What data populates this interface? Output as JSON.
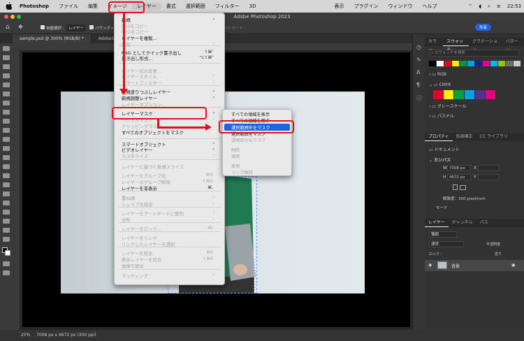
{
  "menubar": {
    "app": "Photoshop",
    "items": [
      "ファイル",
      "編集",
      "イメージ",
      "レイヤー",
      "書式",
      "選択範囲",
      "フィルター",
      "3D",
      "表示",
      "プラグイン",
      "ウィンドウ",
      "ヘルプ"
    ],
    "time": "22:53"
  },
  "window_title": "Adobe Photoshop 2023",
  "options_bar": {
    "auto_select": "自動選択 :",
    "layer": "レイヤー",
    "bounding": "バウンディ",
    "mode3d": "3D モード :",
    "share": "共有"
  },
  "tabs": [
    "sample.psd @ 300% (RGB/8) *",
    "AdobeSto"
  ],
  "status": {
    "zoom": "25%",
    "dims": "7008 px x 4672 px (300 ppi)"
  },
  "layer_menu": {
    "items": [
      {
        "label": "新規",
        "sc": "",
        "sub": true,
        "dis": false
      },
      {
        "label": "CSSをコピー",
        "sc": "",
        "sub": false,
        "dis": true
      },
      {
        "label": "SVGをコピー",
        "sc": "",
        "sub": false,
        "dis": true
      },
      {
        "label": "レイヤーを複製...",
        "sc": "",
        "sub": false,
        "dis": false
      },
      {
        "label": "削除",
        "sc": "",
        "sub": true,
        "dis": true
      },
      {
        "label": "PNG としてクイック書き出し",
        "sc": "⇧⌘'",
        "sub": false,
        "dis": false
      },
      {
        "label": "書き出し形式...",
        "sc": "⌥⇧⌘'",
        "sub": false,
        "dis": false
      },
      {
        "label": "レイヤー名の変更...",
        "sc": "",
        "sub": false,
        "dis": true
      },
      {
        "label": "レイヤースタイル",
        "sc": "",
        "sub": true,
        "dis": true
      },
      {
        "label": "スマートフィルター",
        "sc": "",
        "sub": true,
        "dis": true
      },
      {
        "label": "新規塗りつぶしレイヤー",
        "sc": "",
        "sub": true,
        "dis": false
      },
      {
        "label": "新規調整レイヤー",
        "sc": "",
        "sub": true,
        "dis": false
      },
      {
        "label": "レイヤーオプション...",
        "sc": "",
        "sub": false,
        "dis": true
      },
      {
        "label": "レイヤーマスク",
        "sc": "",
        "sub": true,
        "dis": false
      },
      {
        "label": "ベクトルマスク",
        "sc": "",
        "sub": true,
        "dis": true
      },
      {
        "label": "クリッピングマスク",
        "sc": "",
        "sub": false,
        "dis": true
      },
      {
        "label": "すべてのオブジェクトをマスク",
        "sc": "",
        "sub": false,
        "dis": false
      },
      {
        "label": "スマートオブジェクト",
        "sc": "",
        "sub": true,
        "dis": false
      },
      {
        "label": "ビデオレイヤー",
        "sc": "",
        "sub": true,
        "dis": false
      },
      {
        "label": "ラスタライズ",
        "sc": "",
        "sub": true,
        "dis": true
      },
      {
        "label": "レイヤーに基づく新規スライス",
        "sc": "",
        "sub": false,
        "dis": true
      },
      {
        "label": "レイヤーをグループ化",
        "sc": "⌘G",
        "sub": false,
        "dis": true
      },
      {
        "label": "レイヤーのグループ解除",
        "sc": "⇧⌘G",
        "sub": false,
        "dis": true
      },
      {
        "label": "レイヤーを非表示",
        "sc": "⌘,",
        "sub": false,
        "dis": false
      },
      {
        "label": "重ね順",
        "sc": "",
        "sub": true,
        "dis": true
      },
      {
        "label": "シェイプを結合",
        "sc": "",
        "sub": true,
        "dis": true
      },
      {
        "label": "レイヤーをアートボードに整列",
        "sc": "",
        "sub": true,
        "dis": true
      },
      {
        "label": "分布",
        "sc": "",
        "sub": true,
        "dis": true
      },
      {
        "label": "レイヤーをロック...",
        "sc": "⌘/",
        "sub": false,
        "dis": true
      },
      {
        "label": "レイヤーをリンク",
        "sc": "",
        "sub": false,
        "dis": true
      },
      {
        "label": "リンクしたレイヤーを選択",
        "sc": "",
        "sub": false,
        "dis": true
      },
      {
        "label": "レイヤーを結合",
        "sc": "⌘E",
        "sub": false,
        "dis": true
      },
      {
        "label": "表示レイヤーを結合",
        "sc": "⇧⌘E",
        "sub": false,
        "dis": true
      },
      {
        "label": "画像を統合",
        "sc": "",
        "sub": false,
        "dis": true
      },
      {
        "label": "マッティング",
        "sc": "",
        "sub": true,
        "dis": true
      }
    ]
  },
  "mask_submenu": {
    "items": [
      {
        "label": "すべての領域を表示",
        "dis": false
      },
      {
        "label": "すべての領域を隠す",
        "dis": false
      },
      {
        "label": "選択範囲外をマスク",
        "dis": false
      },
      {
        "label": "選択範囲をマスク",
        "dis": false
      },
      {
        "label": "透明部分をマスク",
        "dis": true
      },
      {
        "label": "削除",
        "dis": true
      },
      {
        "label": "適用",
        "dis": true
      },
      {
        "label": "使用",
        "dis": true
      },
      {
        "label": "リンク解除",
        "dis": true
      }
    ]
  },
  "swatches_panel": {
    "tabs": [
      "カラー",
      "スウォッチ",
      "グラデーション",
      "パターン"
    ],
    "search_placeholder": "スウォッチを検索",
    "folders": [
      "RGB",
      "CMYK",
      "グレースケール",
      "パステル"
    ],
    "top_colors": [
      "#000000",
      "#ffffff",
      "#e30613",
      "#ffed00",
      "#009640",
      "#00a0e9",
      "#1d2088",
      "#e4007f",
      "#00b7ee",
      "#8fc31f",
      "#6e6e6e",
      "#c9c9c9"
    ],
    "cmyk_colors": [
      "#e4002b",
      "#fff100",
      "#00a33e",
      "#00a0e9",
      "#5b2c91",
      "#e5007e"
    ]
  },
  "properties_panel": {
    "tabs": [
      "プロパティ",
      "色調補正",
      "CC ライブラリ"
    ],
    "document": "ドキュメント",
    "canvas": "カンバス",
    "w_label": "W",
    "w_value": "7008 px",
    "h_label": "H",
    "h_value": "4672 px",
    "x_label": "X",
    "y_label": "Y",
    "resolution": "解像度：300 pixel/inch",
    "mode": "モード"
  },
  "layers_panel": {
    "tabs": [
      "レイヤー",
      "チャンネル",
      "パス"
    ],
    "kind": "種類",
    "blend": "通常",
    "opacity": "不透明度",
    "lock": "ロック :",
    "fill": "塗り",
    "layer_name": "背景"
  },
  "colors": {
    "highlight_blue": "#1f63e0",
    "annotation_red": "#e0101a",
    "share_blue": "#2266dd"
  }
}
